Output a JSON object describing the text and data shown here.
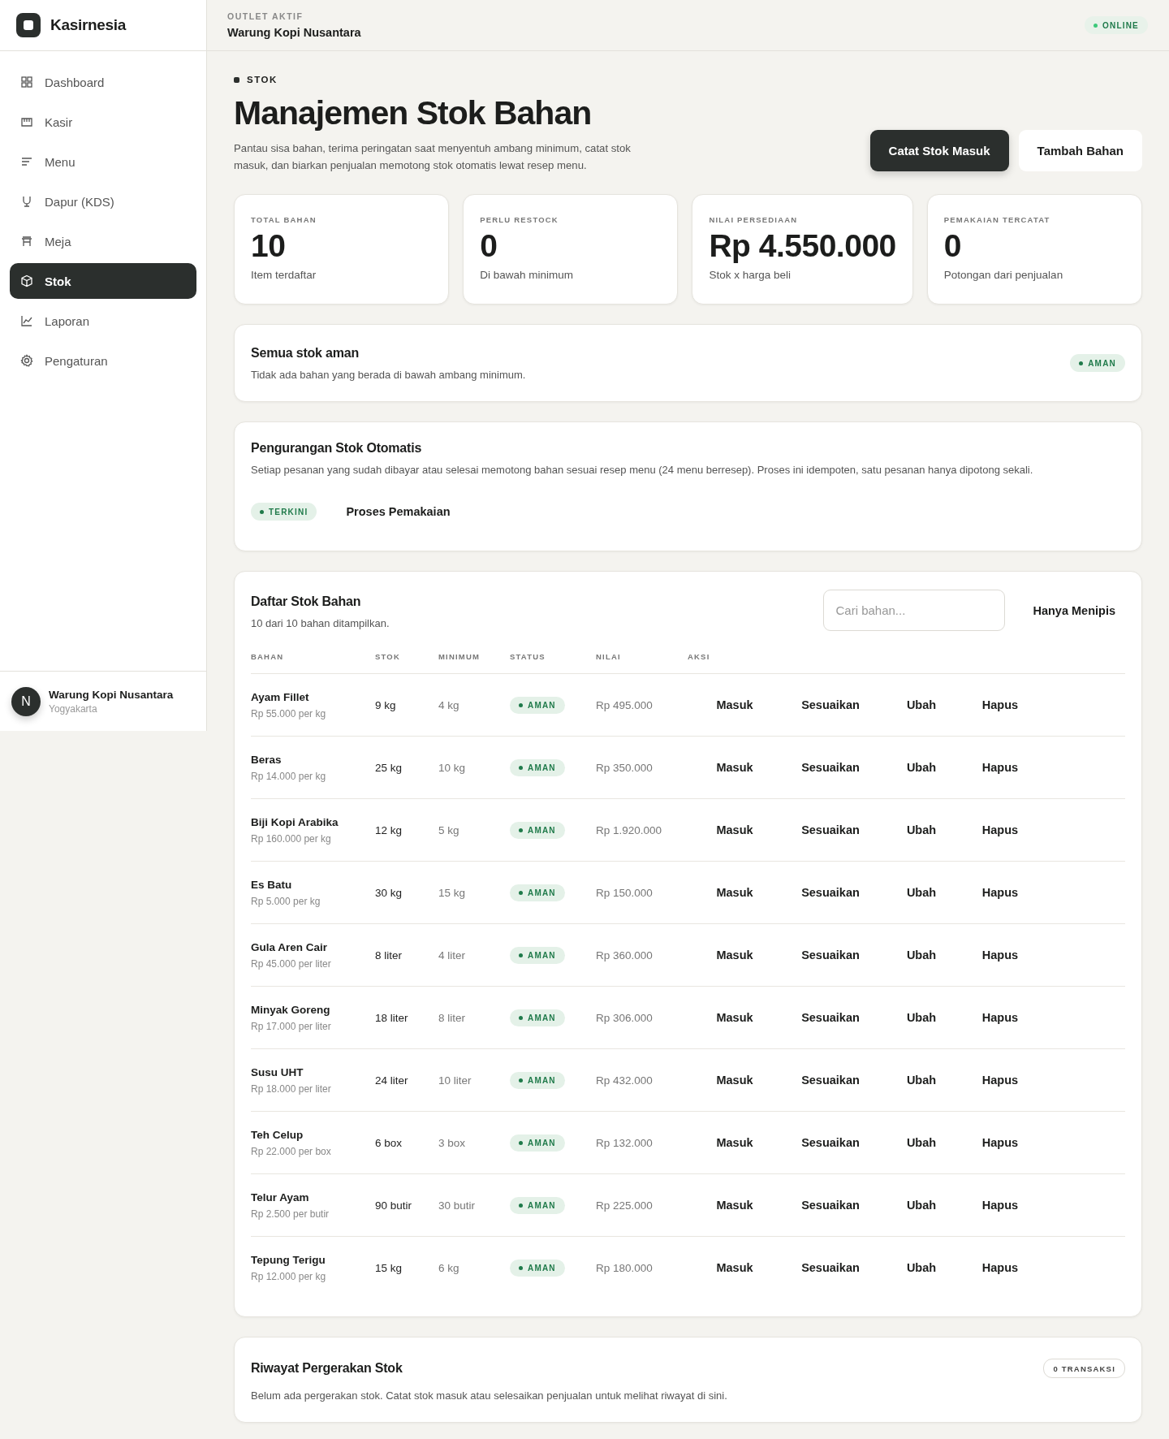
{
  "sidebar": {
    "brand": "Kasirnesia",
    "items": [
      {
        "label": "Dashboard",
        "selected": false
      },
      {
        "label": "Kasir",
        "selected": false
      },
      {
        "label": "Menu",
        "selected": false
      },
      {
        "label": "Dapur (KDS)",
        "selected": false
      },
      {
        "label": "Meja",
        "selected": false
      },
      {
        "label": "Stok",
        "selected": true
      },
      {
        "label": "Laporan",
        "selected": false
      },
      {
        "label": "Pengaturan",
        "selected": false
      }
    ],
    "footer": {
      "name": "Warung Kopi Nusantara",
      "location": "Yogyakarta",
      "avatar": "N"
    }
  },
  "topbar": {
    "label": "OUTLET AKTIF",
    "outlet": "Warung Kopi Nusantara",
    "status": "ONLINE"
  },
  "page": {
    "eyebrow": "STOK",
    "title": "Manajemen Stok Bahan",
    "description": "Pantau sisa bahan, terima peringatan saat menyentuh ambang minimum, catat stok masuk, dan biarkan penjualan memotong stok otomatis lewat resep menu.",
    "buttons": [
      {
        "label": "Catat Stok Masuk",
        "kind": "primary"
      },
      {
        "label": "Tambah Bahan",
        "kind": "secondary"
      }
    ]
  },
  "stats": [
    {
      "label": "TOTAL BAHAN",
      "value": "10",
      "caption": "Item terdaftar"
    },
    {
      "label": "PERLU RESTOCK",
      "value": "0",
      "caption": "Di bawah minimum"
    },
    {
      "label": "NILAI PERSEDIAAN",
      "value": "Rp 4.550.000",
      "caption": "Stok x harga beli"
    },
    {
      "label": "PEMAKAIAN TERCATAT",
      "value": "0",
      "caption": "Potongan dari penjualan"
    }
  ],
  "alert": {
    "title": "Semua stok aman",
    "text": "Tidak ada bahan yang berada di bawah ambang minimum.",
    "badge": "AMAN"
  },
  "auto_deduction": {
    "title": "Pengurangan Stok Otomatis",
    "text": "Setiap pesanan yang sudah dibayar atau selesai memotong bahan sesuai resep menu (24 menu berresep). Proses ini idempoten, satu pesanan hanya dipotong sekali.",
    "badge": "TERKINI",
    "action": "Proses Pemakaian"
  },
  "table": {
    "title": "Daftar Stok Bahan",
    "subtitle": "10 dari 10 bahan ditampilkan.",
    "search": {
      "placeholder": "Cari bahan..."
    },
    "filter": "Hanya Menipis",
    "columns": [
      "BAHAN",
      "STOK",
      "MINIMUM",
      "STATUS",
      "NILAI",
      "AKSI"
    ],
    "rows": [
      {
        "name": "Ayam Fillet",
        "price": "Rp 55.000 per kg",
        "stock": "9 kg",
        "minimum": "4 kg",
        "status": "AMAN",
        "value": "Rp 495.000",
        "actions": [
          "Masuk",
          "Sesuaikan",
          "Ubah",
          "Hapus"
        ]
      },
      {
        "name": "Beras",
        "price": "Rp 14.000 per kg",
        "stock": "25 kg",
        "minimum": "10 kg",
        "status": "AMAN",
        "value": "Rp 350.000",
        "actions": [
          "Masuk",
          "Sesuaikan",
          "Ubah",
          "Hapus"
        ]
      },
      {
        "name": "Biji Kopi Arabika",
        "price": "Rp 160.000 per kg",
        "stock": "12 kg",
        "minimum": "5 kg",
        "status": "AMAN",
        "value": "Rp 1.920.000",
        "actions": [
          "Masuk",
          "Sesuaikan",
          "Ubah",
          "Hapus"
        ]
      },
      {
        "name": "Es Batu",
        "price": "Rp 5.000 per kg",
        "stock": "30 kg",
        "minimum": "15 kg",
        "status": "AMAN",
        "value": "Rp 150.000",
        "actions": [
          "Masuk",
          "Sesuaikan",
          "Ubah",
          "Hapus"
        ]
      },
      {
        "name": "Gula Aren Cair",
        "price": "Rp 45.000 per liter",
        "stock": "8 liter",
        "minimum": "4 liter",
        "status": "AMAN",
        "value": "Rp 360.000",
        "actions": [
          "Masuk",
          "Sesuaikan",
          "Ubah",
          "Hapus"
        ]
      },
      {
        "name": "Minyak Goreng",
        "price": "Rp 17.000 per liter",
        "stock": "18 liter",
        "minimum": "8 liter",
        "status": "AMAN",
        "value": "Rp 306.000",
        "actions": [
          "Masuk",
          "Sesuaikan",
          "Ubah",
          "Hapus"
        ]
      },
      {
        "name": "Susu UHT",
        "price": "Rp 18.000 per liter",
        "stock": "24 liter",
        "minimum": "10 liter",
        "status": "AMAN",
        "value": "Rp 432.000",
        "actions": [
          "Masuk",
          "Sesuaikan",
          "Ubah",
          "Hapus"
        ]
      },
      {
        "name": "Teh Celup",
        "price": "Rp 22.000 per box",
        "stock": "6 box",
        "minimum": "3 box",
        "status": "AMAN",
        "value": "Rp 132.000",
        "actions": [
          "Masuk",
          "Sesuaikan",
          "Ubah",
          "Hapus"
        ]
      },
      {
        "name": "Telur Ayam",
        "price": "Rp 2.500 per butir",
        "stock": "90 butir",
        "minimum": "30 butir",
        "status": "AMAN",
        "value": "Rp 225.000",
        "actions": [
          "Masuk",
          "Sesuaikan",
          "Ubah",
          "Hapus"
        ]
      },
      {
        "name": "Tepung Terigu",
        "price": "Rp 12.000 per kg",
        "stock": "15 kg",
        "minimum": "6 kg",
        "status": "AMAN",
        "value": "Rp 180.000",
        "actions": [
          "Masuk",
          "Sesuaikan",
          "Ubah",
          "Hapus"
        ]
      }
    ]
  },
  "history": {
    "title": "Riwayat Pergerakan Stok",
    "text": "Belum ada pergerakan stok. Catat stok masuk atau selesaikan penjualan untuk melihat riwayat di sini.",
    "badge": "0 TRANSAKSI"
  }
}
